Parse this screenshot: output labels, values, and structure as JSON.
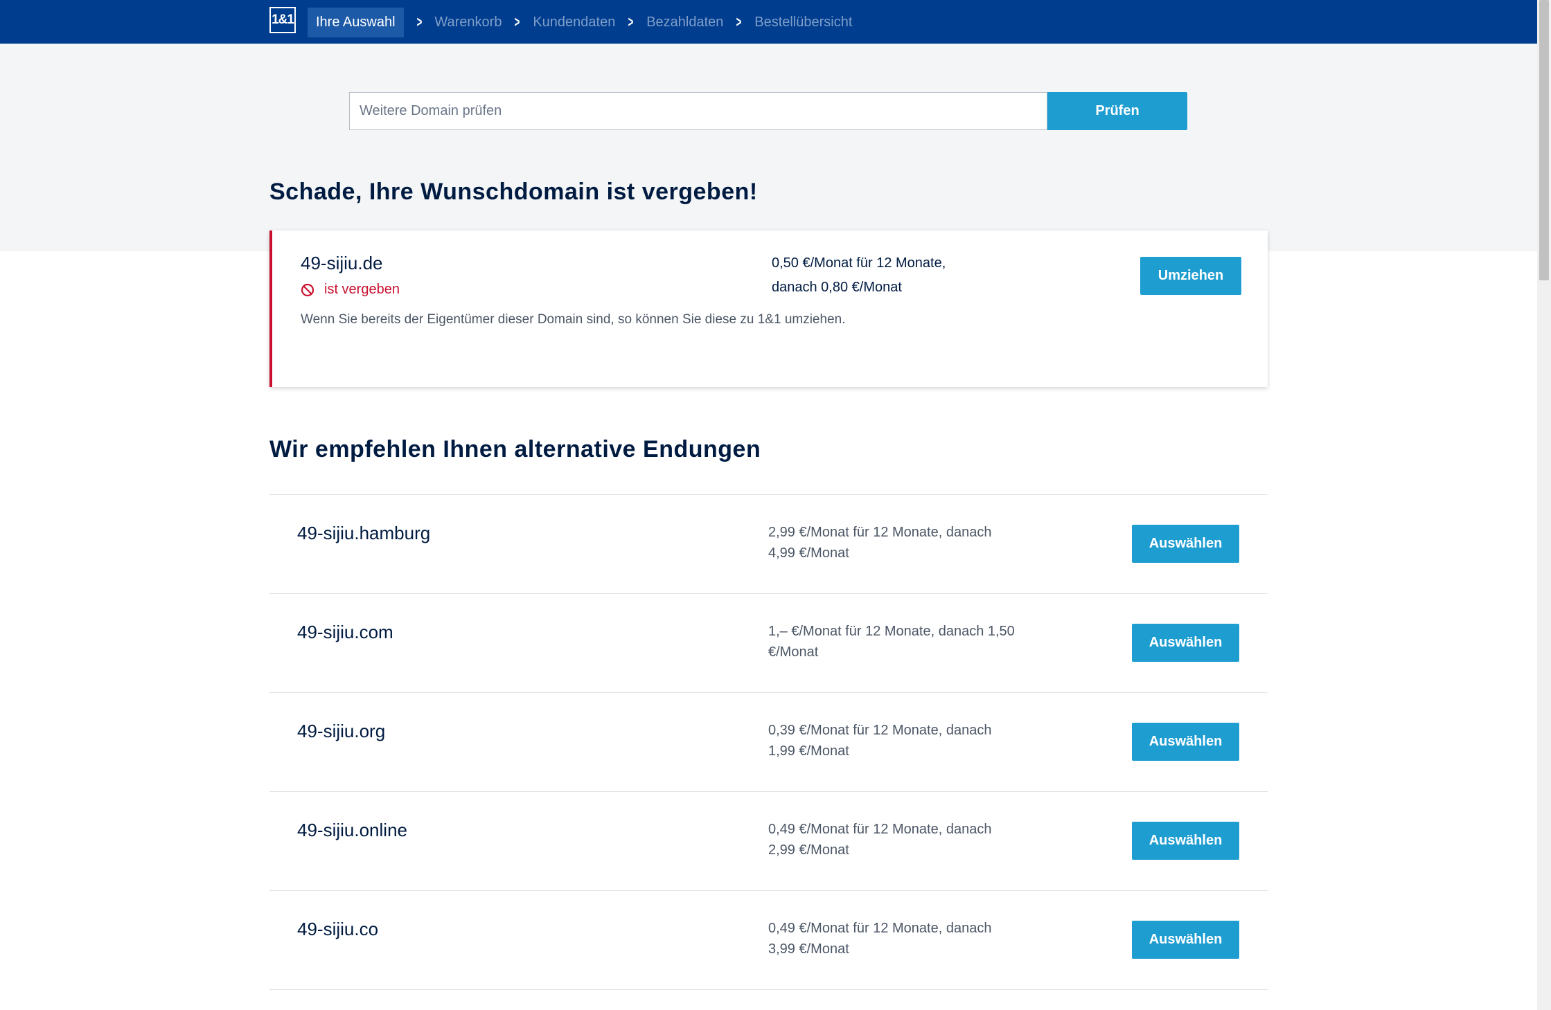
{
  "header": {
    "logo": "1&1",
    "steps": [
      "Ihre Auswahl",
      "Warenkorb",
      "Kundendaten",
      "Bezahldaten",
      "Bestellübersicht"
    ]
  },
  "search": {
    "placeholder": "Weitere Domain prüfen",
    "value": "",
    "button_label": "Prüfen"
  },
  "taken": {
    "heading": "Schade, Ihre Wunschdomain ist vergeben!",
    "domain": "49-sijiu.de",
    "status": "ist vergeben",
    "price_line1": "0,50 €/Monat für 12 Monate,",
    "price_line2": "danach 0,80 €/Monat",
    "info": "Wenn Sie bereits der Eigentümer dieser Domain sind, so können Sie diese zu 1&1 umziehen.",
    "button_label": "Umziehen"
  },
  "alternatives": {
    "heading": "Wir empfehlen Ihnen alternative Endungen",
    "button_label": "Auswählen",
    "items": [
      {
        "domain": "49-sijiu.hamburg",
        "price": "2,99 €/Monat für 12 Monate, danach 4,99 €/Monat"
      },
      {
        "domain": "49-sijiu.com",
        "price": "1,– €/Monat für 12 Monate, danach 1,50 €/Monat"
      },
      {
        "domain": "49-sijiu.org",
        "price": "0,39 €/Monat für 12 Monate, danach 1,99 €/Monat"
      },
      {
        "domain": "49-sijiu.online",
        "price": "0,49 €/Monat für 12 Monate, danach 2,99 €/Monat"
      },
      {
        "domain": "49-sijiu.co",
        "price": "0,49 €/Monat für 12 Monate, danach 3,99 €/Monat"
      }
    ]
  },
  "colors": {
    "header_bg": "#003d8f",
    "accent_button": "#1e9dd1",
    "error": "#c8102e",
    "text_dark": "#001b41"
  },
  "icons": {
    "status_icon": "forbidden-icon",
    "step_separator": "chevron-right-icon"
  }
}
